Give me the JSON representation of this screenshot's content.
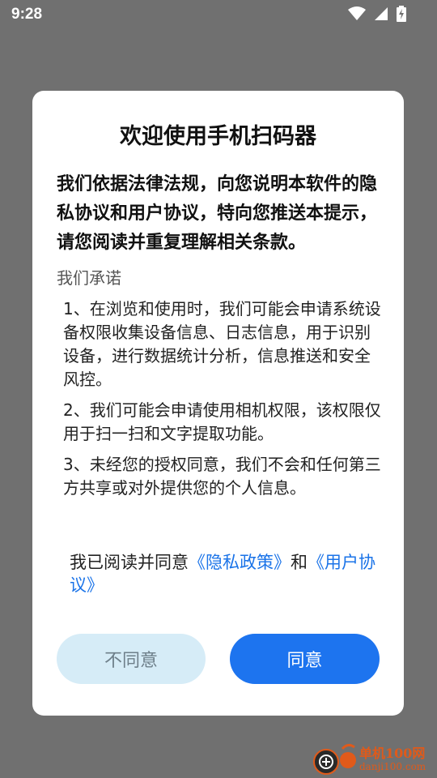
{
  "status_bar": {
    "time": "9:28"
  },
  "dialog": {
    "title": "欢迎使用手机扫码器",
    "lead": "我们依据法律法规，向您说明本软件的隐私协议和用户协议，特向您推送本提示，请您阅读并重复理解相关条款。",
    "promise_heading": "我们承诺",
    "items": [
      "1、在浏览和使用时，我们可能会申请系统设备权限收集设备信息、日志信息，用于识别设备，进行数据统计分析，信息推送和安全风控。",
      "2、我们可能会申请使用相机权限，该权限仅用于扫一扫和文字提取功能。",
      "3、未经您的授权同意，我们不会和任何第三方共享或对外提供您的个人信息。"
    ],
    "consent": {
      "prefix": "我已阅读并同意",
      "privacy_link": "《隐私政策》",
      "and": "和",
      "terms_link": "《用户协议》"
    },
    "buttons": {
      "disagree": "不同意",
      "agree": "同意"
    }
  },
  "watermark": {
    "text": "单机100网",
    "url": "danji100.com"
  },
  "colors": {
    "accent": "#1d74ef",
    "link": "#1a73e8",
    "disagree_bg": "#d6ecf7",
    "overlay": "#707070"
  }
}
